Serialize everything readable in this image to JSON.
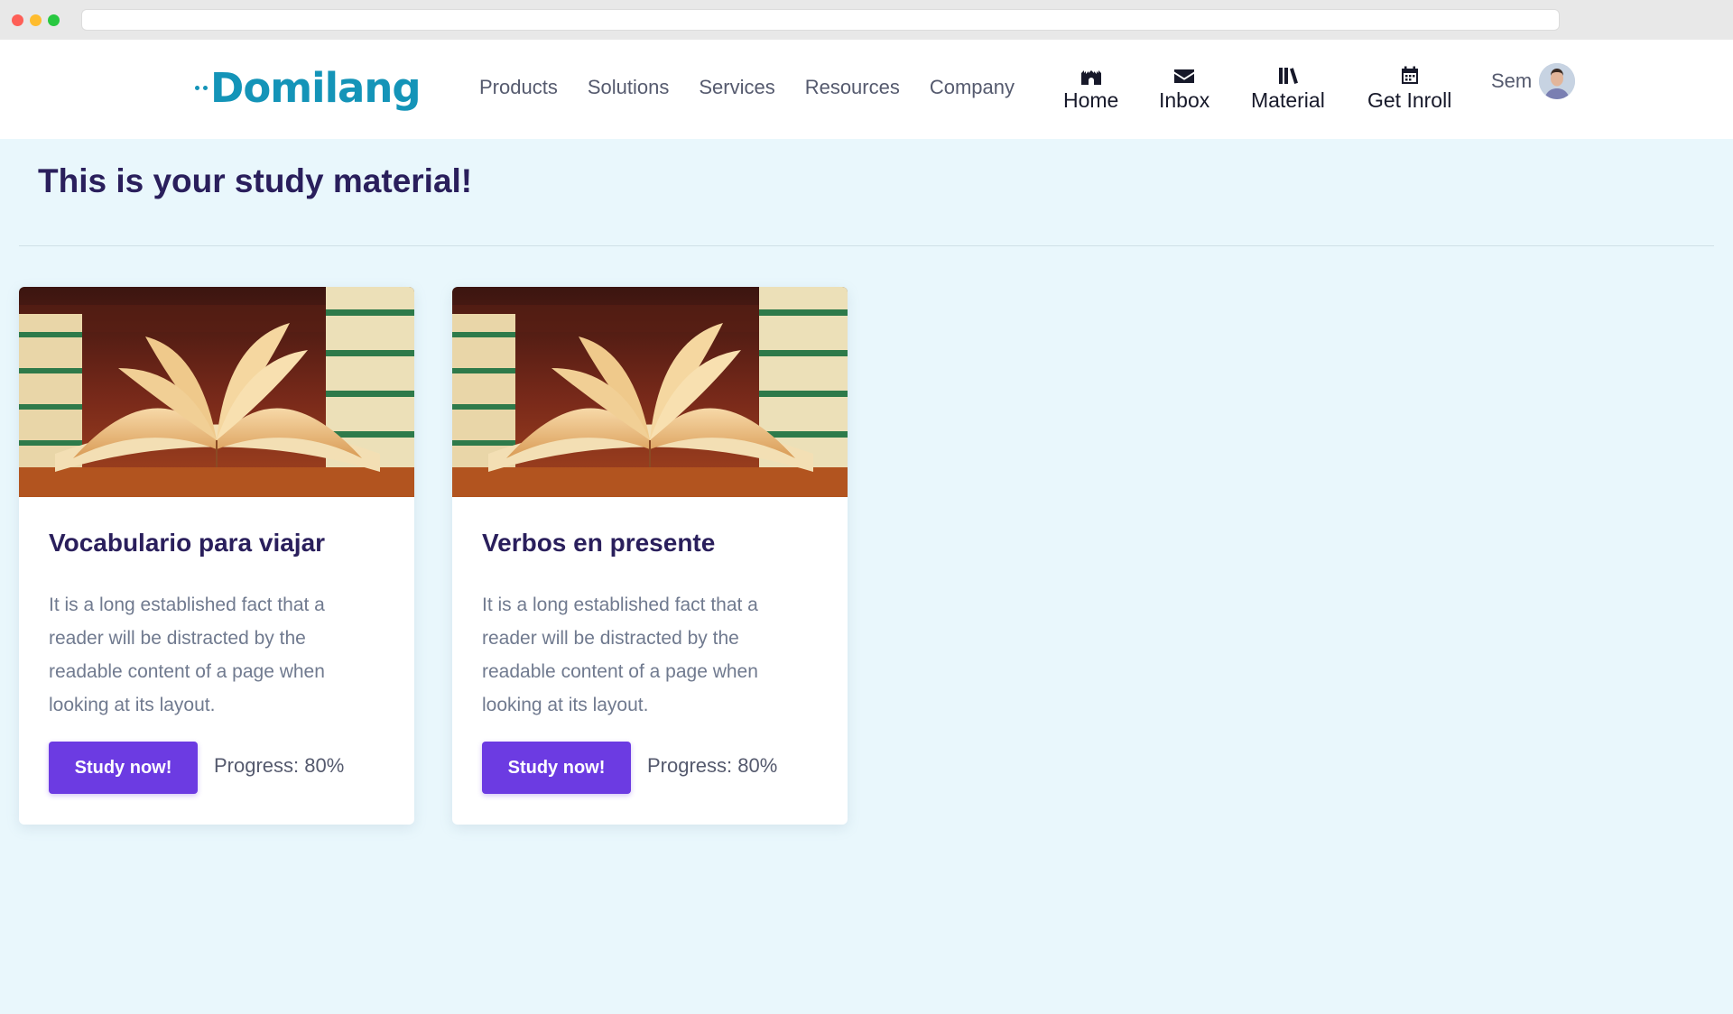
{
  "brand": {
    "name": "Domilang",
    "logo_text": "Domilang",
    "color": "#1494b8"
  },
  "nav": {
    "links": [
      "Products",
      "Solutions",
      "Services",
      "Resources",
      "Company"
    ],
    "icon_items": [
      {
        "label": "Home",
        "icon": "home-icon"
      },
      {
        "label": "Inbox",
        "icon": "envelope-icon"
      },
      {
        "label": "Material",
        "icon": "books-icon"
      },
      {
        "label": "Get Inroll",
        "icon": "calendar-icon"
      }
    ]
  },
  "user": {
    "name": "Sem",
    "avatar": "user-avatar"
  },
  "main": {
    "title": "This is your study material!"
  },
  "cards": [
    {
      "title": "Vocabulario para viajar",
      "description": "It is a long established fact that a reader will be distracted by the readable content of a page when looking at its layout.",
      "button_label": "Study now!",
      "progress_label": "Progress: 80%",
      "progress_value": 0.8
    },
    {
      "title": "Verbos en presente",
      "description": "It is a long established fact that a reader will be distracted by the readable content of a page when looking at its layout.",
      "button_label": "Study now!",
      "progress_label": "Progress: 80%",
      "progress_value": 0.8
    }
  ],
  "colors": {
    "accent": "#6c3be2",
    "heading": "#2a1f5c",
    "background": "#e9f7fc"
  }
}
